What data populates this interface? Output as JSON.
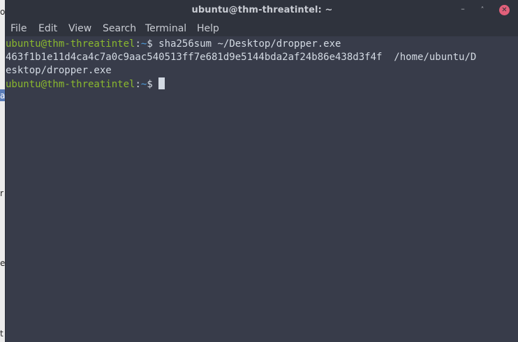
{
  "window": {
    "title": "ubuntu@thm-threatintel: ~",
    "minimize_glyph": "–",
    "maximize_glyph": "˄",
    "close_glyph": "✕"
  },
  "menubar": {
    "file": "File",
    "edit": "Edit",
    "view": "View",
    "search": "Search",
    "terminal": "Terminal",
    "help": "Help"
  },
  "terminal": {
    "prompt_user": "ubuntu@thm-threatintel",
    "prompt_colon": ":",
    "prompt_path": "~",
    "prompt_symbol": "$ ",
    "command": "sha256sum ~/Desktop/dropper.exe",
    "output_line_1": "463f1b1e11d4ca4c7a0c9aac540513ff7e681d9e5144bda2af24b86e438d3f4f  /home/ubuntu/D",
    "output_line_2": "esktop/dropper.exe"
  },
  "desktop_fragments": [
    "o",
    "a",
    "r",
    "e",
    "t"
  ],
  "colors": {
    "terminal_bg": "#383c4a",
    "titlebar_bg": "#2f333d",
    "prompt_user": "#8ab82e",
    "prompt_path": "#4f9fde",
    "text": "#d3dae3",
    "close_button": "#e2607a"
  }
}
